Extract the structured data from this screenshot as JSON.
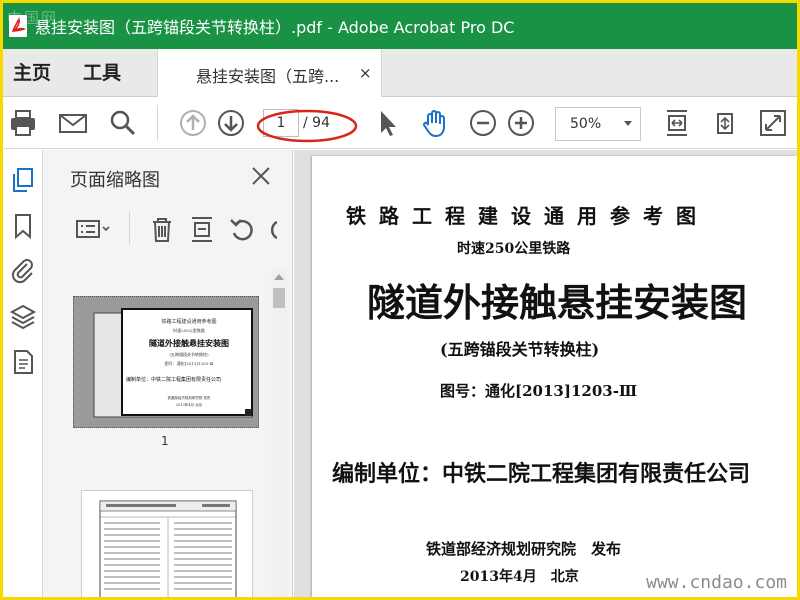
{
  "titlebar": {
    "watermark": "中国网",
    "title": "悬挂安装图（五跨锚段关节转换柱）.pdf - Adobe Acrobat Pro DC"
  },
  "tabs": {
    "home": "主页",
    "tools": "工具",
    "document": "悬挂安装图（五跨...",
    "close": "×"
  },
  "toolbar": {
    "current_page": "1",
    "total_pages": "/ 94",
    "zoom": "50%"
  },
  "panel": {
    "title": "页面缩略图",
    "thumb1": {
      "series": "铁路工程建设通用参考图",
      "speed": "时速250公里铁路",
      "title": "隧道外接触悬挂安装图",
      "subtitle": "(五跨锚段关节转换柱)",
      "drawing": "图号：通化[2013]1203-Ⅲ",
      "compiler": "编制单位：中铁二院工程集团有限责任公司",
      "publisher": "铁道部经济规划研究院 发布",
      "date": "2013年4月 北京"
    },
    "thumb1_number": "1"
  },
  "document": {
    "series": "铁路工程建设通用参考图",
    "speed": "时速250公里铁路",
    "title": "隧道外接触悬挂安装图",
    "subtitle": "(五跨锚段关节转换柱)",
    "drawing_no": "图号：通化[2013]1203-Ⅲ",
    "compiler": "编制单位：中铁二院工程集团有限责任公司",
    "publisher": "铁道部经济规划研究院　发布",
    "date": "2013年4月　北京"
  },
  "watermark_bottom": "www.cndao.com",
  "colors": {
    "titlebar": "#199246",
    "border": "#f7d900",
    "annotation": "#d8261c"
  }
}
